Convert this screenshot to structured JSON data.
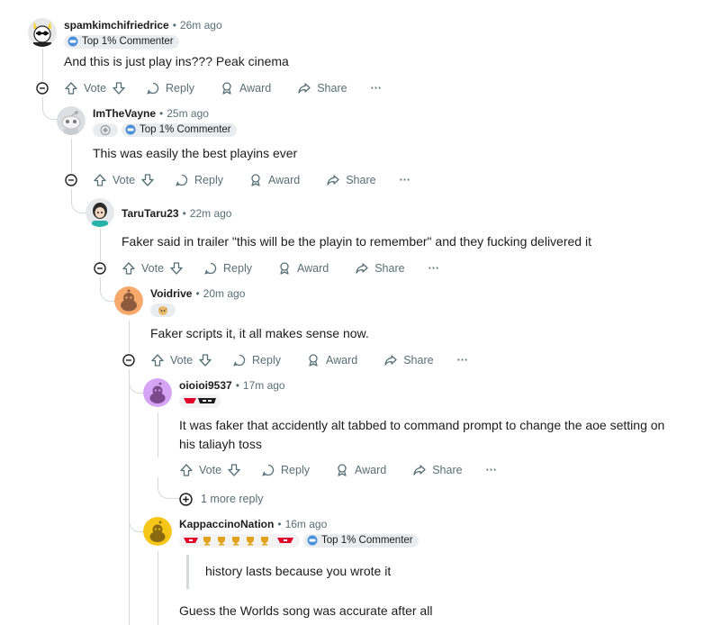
{
  "actions": {
    "vote": "Vote",
    "reply": "Reply",
    "award": "Award",
    "share": "Share",
    "more": "···"
  },
  "badge_label": "Top 1% Commenter",
  "colors": {
    "text": "#1c1c1c",
    "meta": "#576f76",
    "thread_line": "#d5d9dc",
    "pill_bg": "#eaedef"
  },
  "comments": [
    {
      "username": "spamkimchifriedrice",
      "time": "26m ago",
      "badge": "Top 1% Commenter",
      "text": "And this is just play ins??? Peak cinema"
    },
    {
      "username": "ImTheVayne",
      "time": "25m ago",
      "badge": "Top 1% Commenter",
      "text": "This was easily the best playins ever"
    },
    {
      "username": "TaruTaru23",
      "time": "22m ago",
      "text": "Faker said in trailer \"this will be the playin to remember\" and they fucking delivered it"
    },
    {
      "username": "Voidrive",
      "time": "20m ago",
      "text": "Faker scripts it, it all makes sense now."
    },
    {
      "username": "oioioi9537",
      "time": "17m ago",
      "text": "It was faker that accidently alt tabbed to command prompt to change the aoe setting on his taliayh toss",
      "more_replies": "1 more reply"
    },
    {
      "username": "KappaccinoNation",
      "time": "16m ago",
      "badge": "Top 1% Commenter",
      "quote": "history lasts because you wrote it",
      "text": "Guess the Worlds song was accurate after all"
    }
  ]
}
